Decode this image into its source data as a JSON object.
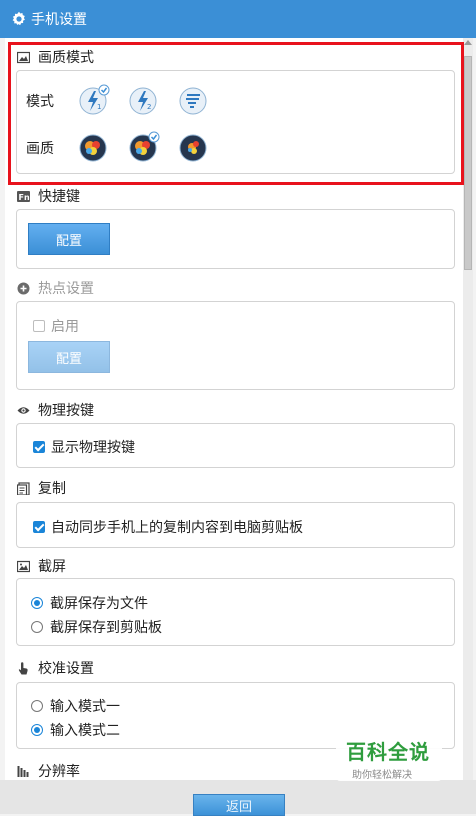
{
  "window": {
    "title": "手机设置"
  },
  "quality_mode": {
    "heading": "画质模式",
    "mode_label": "模式",
    "quality_label": "画质",
    "modes": [
      {
        "icon": "lightning-1-icon",
        "selected": true
      },
      {
        "icon": "lightning-2-icon",
        "selected": false
      },
      {
        "icon": "lightning-3-icon",
        "selected": false
      }
    ],
    "qualities": [
      {
        "icon": "quality-balloon-icon",
        "selected": false
      },
      {
        "icon": "quality-balloon-icon",
        "selected": true
      },
      {
        "icon": "quality-balloon-icon",
        "selected": false
      }
    ]
  },
  "shortcuts": {
    "heading": "快捷键",
    "configure_label": "配置"
  },
  "hotspot": {
    "heading": "热点设置",
    "enable_label": "启用",
    "enable_checked": false,
    "configure_label": "配置",
    "disabled": true
  },
  "physical_keys": {
    "heading": "物理按键",
    "show_label": "显示物理按键",
    "show_checked": true
  },
  "copy": {
    "heading": "复制",
    "sync_label": "自动同步手机上的复制内容到电脑剪贴板",
    "sync_checked": true
  },
  "screenshot": {
    "heading": "截屏",
    "options": [
      {
        "label": "截屏保存为文件",
        "selected": true
      },
      {
        "label": "截屏保存到剪贴板",
        "selected": false
      }
    ]
  },
  "calibration": {
    "heading": "校准设置",
    "options": [
      {
        "label": "输入模式一",
        "selected": false
      },
      {
        "label": "输入模式二",
        "selected": true
      }
    ]
  },
  "resolution": {
    "heading": "分辨率"
  },
  "footer": {
    "back_label": "返回"
  },
  "watermark": {
    "brand": "百科全说",
    "tagline": "助你轻松解决"
  },
  "colors": {
    "title_bar": "#3b8fd6",
    "accent": "#1a85d8",
    "highlight": "#e8121c"
  }
}
